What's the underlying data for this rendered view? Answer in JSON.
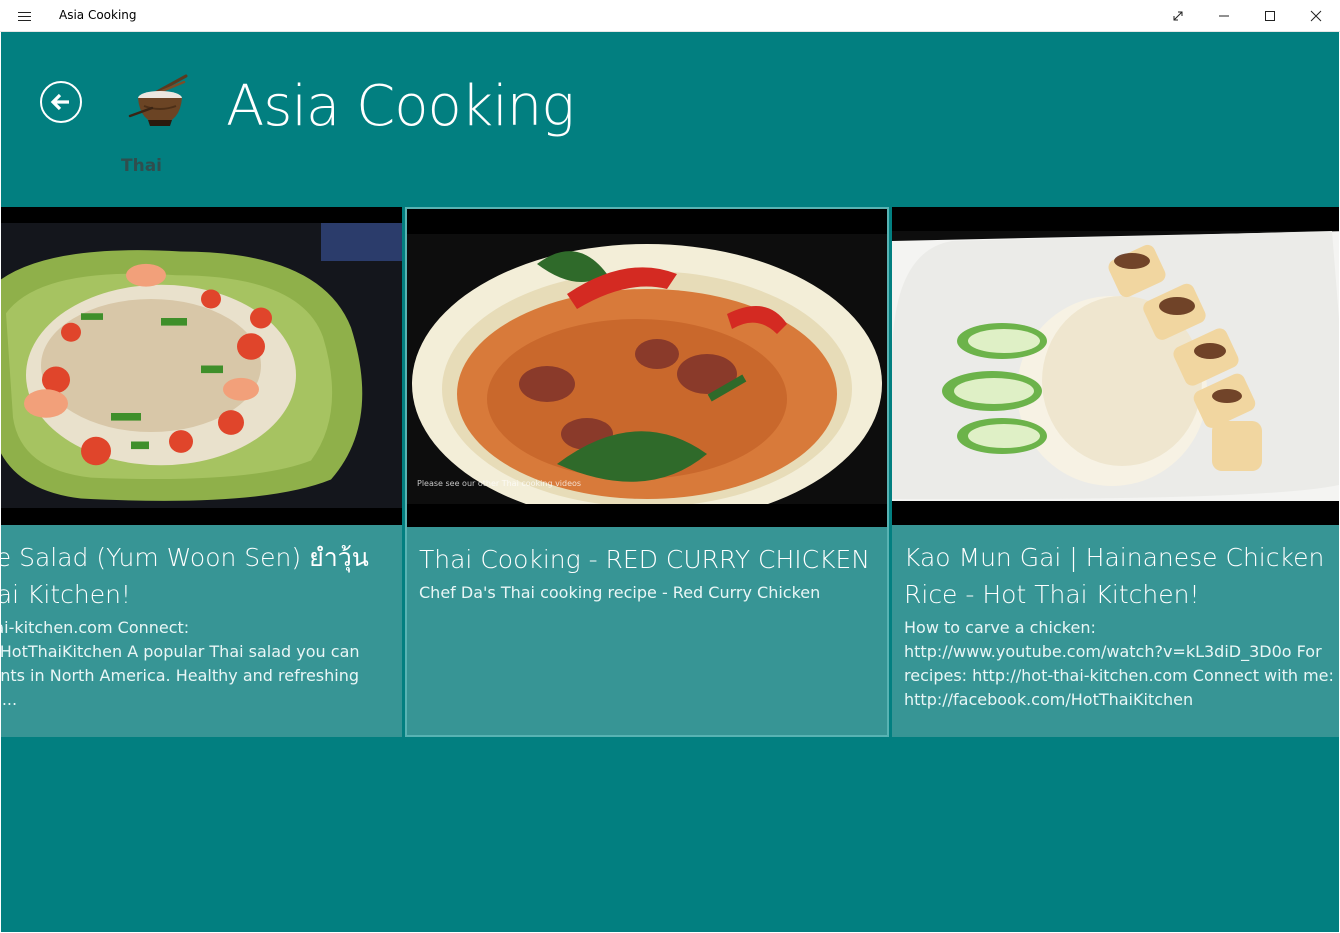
{
  "window": {
    "app_title": "Asia Cooking",
    "menu_icon": "hamburger-icon",
    "buttons": [
      "fullscreen-icon",
      "minimize-icon",
      "maximize-icon",
      "close-icon"
    ]
  },
  "header": {
    "back_icon": "back-arrow-icon",
    "logo_icon": "cooking-bowl-icon",
    "title": "Asia Cooking",
    "category": "Thai"
  },
  "cards": [
    {
      "title": "Glass Noodle Salad (Yum Woon Sen) ยำวุ้นเส้น - Hot Thai Kitchen!",
      "description": "Recipe: http://hot-thai-kitchen.com Connect: http://facebook.com/HotThaiKitchen A popular Thai salad you can find in most restaurants in North America. Healthy and refreshing mix of glass noodles,...",
      "thumbnail": "glass-noodle-salad-image"
    },
    {
      "title": "Thai Cooking - RED CURRY CHICKEN",
      "description": "Chef Da's Thai cooking recipe - Red Curry Chicken",
      "thumbnail": "red-curry-chicken-image",
      "thumbnail_caption": "Please see our other Thai cooking videos",
      "selected": true
    },
    {
      "title": "Kao Mun Gai | Hainanese Chicken Rice - Hot Thai Kitchen!",
      "description": "How to carve a chicken: http://www.youtube.com/watch?v=kL3diD_3D0o For recipes: http://hot-thai-kitchen.com Connect with me: http://facebook.com/HotThaiKitchen",
      "thumbnail": "chicken-rice-image"
    }
  ],
  "colors": {
    "background": "#027f80",
    "card_info": "#379595",
    "selected_border": "#58b3b3"
  }
}
